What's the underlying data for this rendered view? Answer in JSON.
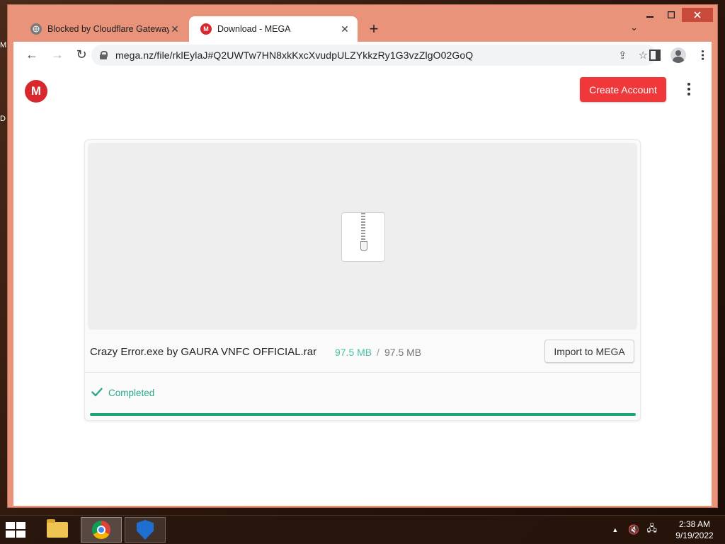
{
  "desktop": {
    "edge_letter_1": "M",
    "edge_letter_2": "D"
  },
  "browser": {
    "tabs": [
      {
        "title": "Blocked by Cloudflare Gateway",
        "active": false,
        "icon": "globe-icon"
      },
      {
        "title": "Download - MEGA",
        "active": true,
        "icon": "mega-favicon"
      }
    ],
    "new_tab_label": "+",
    "url": "mega.nz/file/rklEylaJ#Q2UWTw7HN8xkKxcXvudpULZYkkzRy1G3vzZlgO02GoQ"
  },
  "page": {
    "logo_letter": "M",
    "create_account_label": "Create Account",
    "file": {
      "name": "Crazy Error.exe by GAURA VNFC OFFICIAL.rar",
      "downloaded": "97.5 MB",
      "separator": "/",
      "total": "97.5 MB",
      "import_label": "Import to MEGA",
      "status": "Completed",
      "progress_percent": 100
    }
  },
  "taskbar": {
    "time": "2:38 AM",
    "date": "9/19/2022"
  },
  "colors": {
    "mega_red": "#d9272e",
    "create_btn": "#f0373a",
    "success_green": "#1aa67a",
    "size_teal": "#4bc1a6"
  }
}
